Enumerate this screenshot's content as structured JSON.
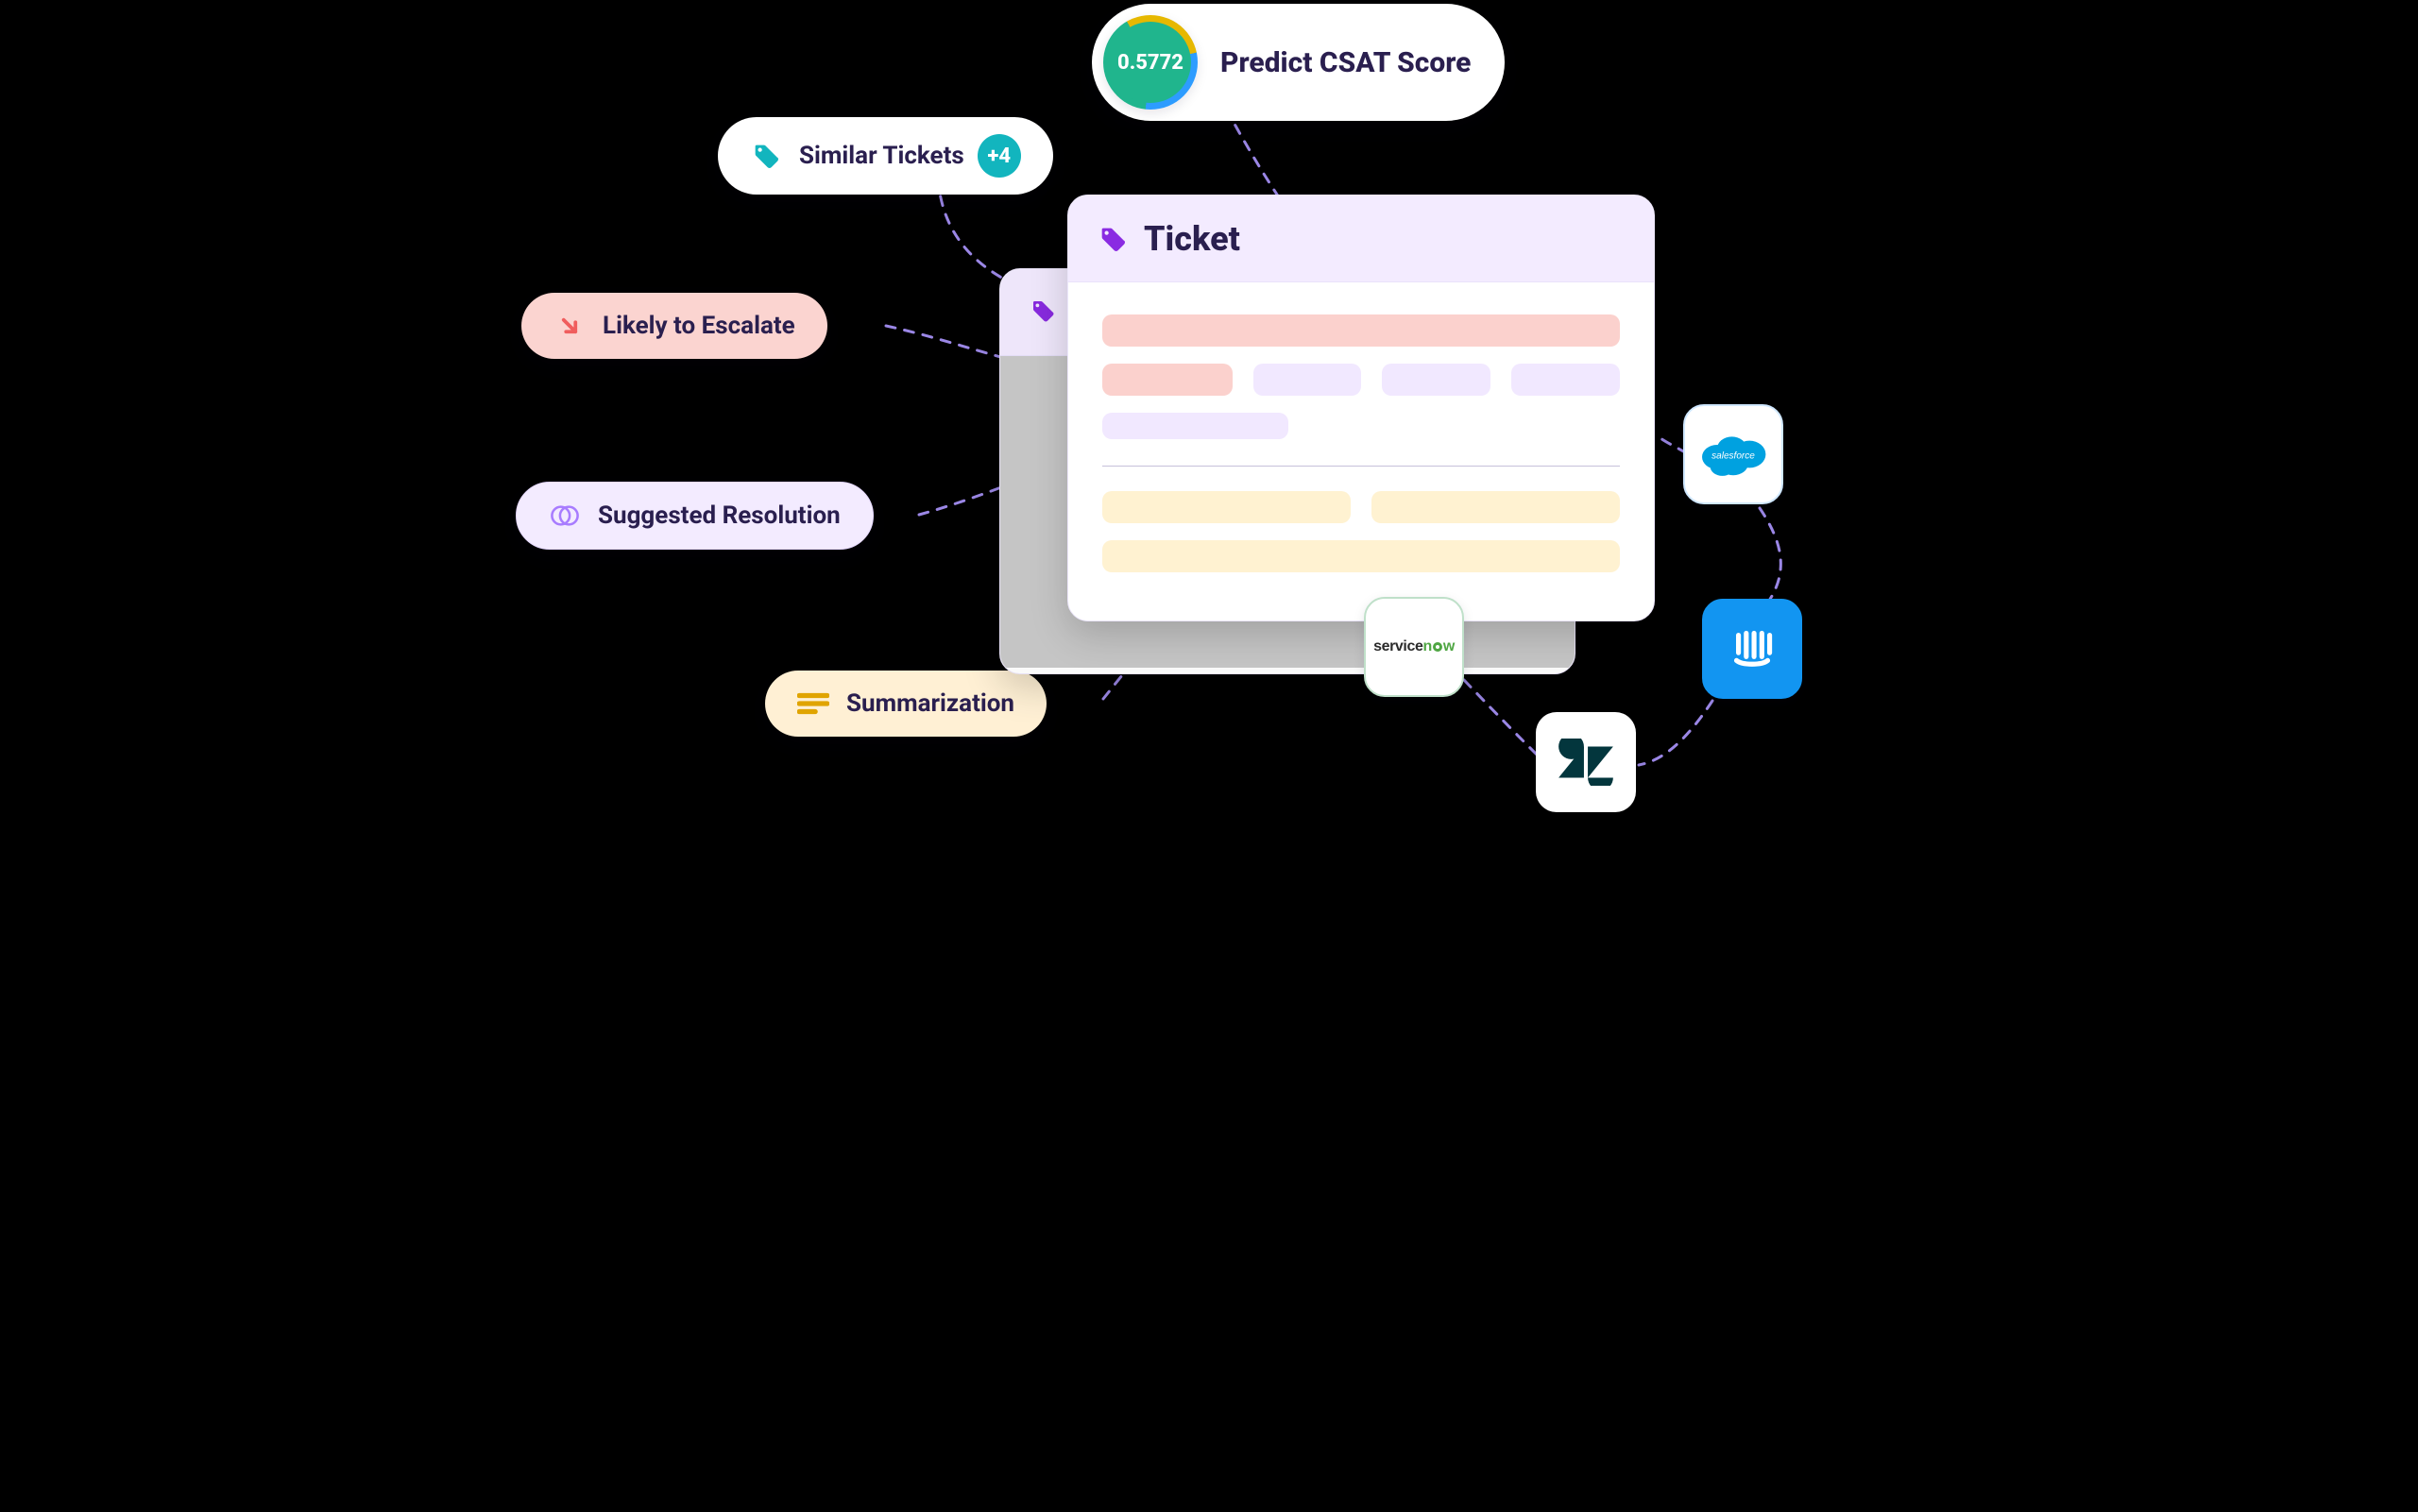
{
  "pills": {
    "similar": {
      "label": "Similar Tickets",
      "badge": "+4"
    },
    "csat": {
      "score": "0.5772",
      "label": "Predict CSAT Score"
    },
    "escalate": {
      "label": "Likely to Escalate"
    },
    "suggested": {
      "label": "Suggested Resolution"
    },
    "summary": {
      "label": "Summarization"
    }
  },
  "ticket": {
    "title": "Ticket"
  },
  "integrations": {
    "servicenow": "servicenow",
    "zendesk": "zendesk",
    "intercom": "intercom",
    "salesforce": "salesforce"
  },
  "colors": {
    "teal": "#12B5BE",
    "purple": "#8A2BE2",
    "lav": "#F3EBFF",
    "pink": "#FBD4D0",
    "yellow": "#FFF0D4",
    "green": "#20B58D",
    "blue": "#1295F1",
    "ink": "#2A1F4F"
  }
}
